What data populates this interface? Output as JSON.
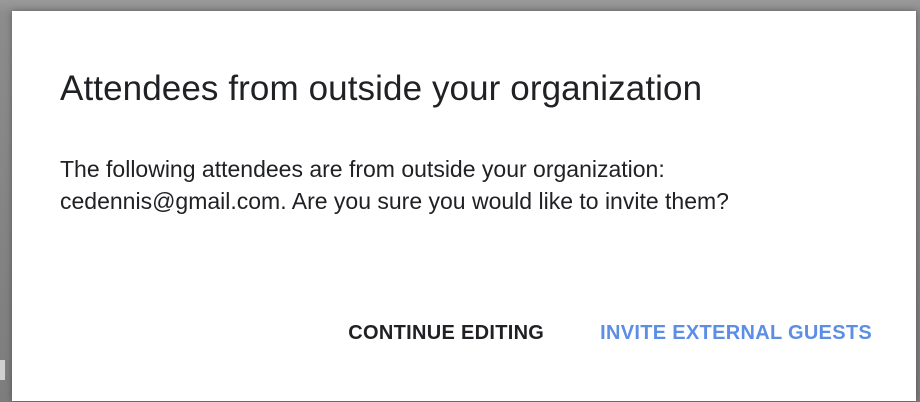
{
  "dialog": {
    "title": "Attendees from outside your organization",
    "body": "The following attendees are from outside your organization: cedennis@gmail.com. Are you sure you would like to invite them?",
    "actions": {
      "secondary_label": "CONTINUE EDITING",
      "primary_label": "INVITE EXTERNAL GUESTS"
    }
  },
  "colors": {
    "primary_action": "#5c8ee6",
    "text": "#202124",
    "backdrop": "#8a8a8a"
  }
}
